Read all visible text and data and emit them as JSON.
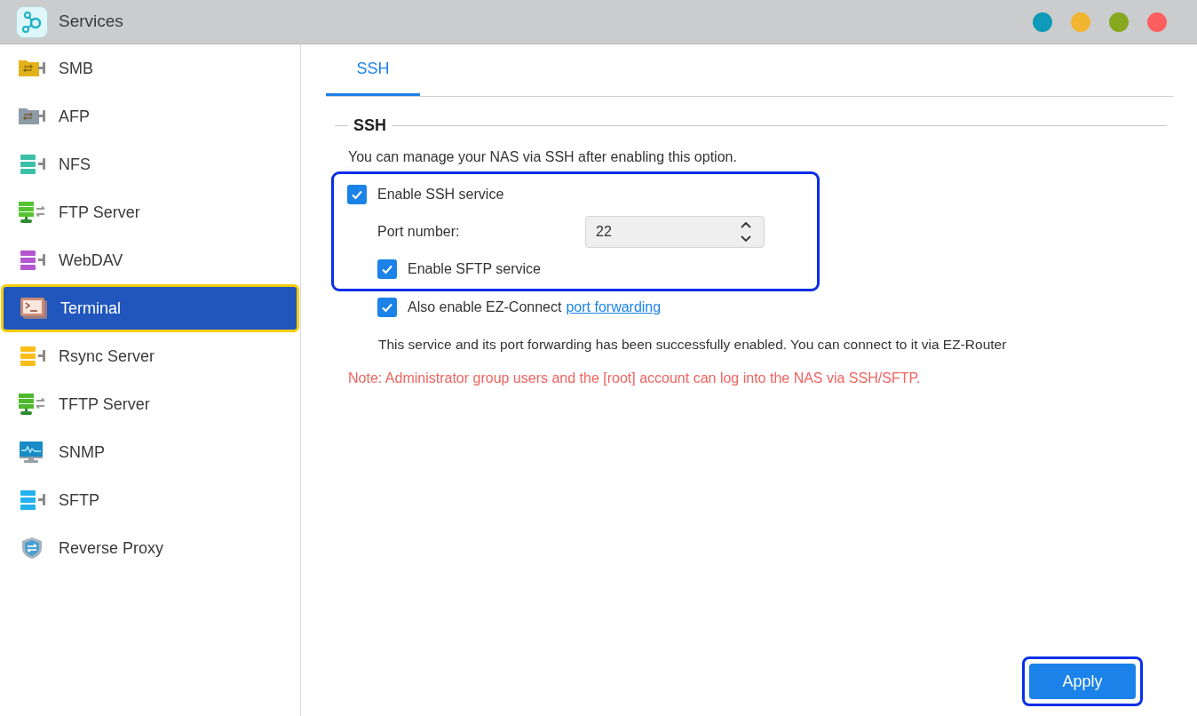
{
  "window": {
    "title": "Services",
    "controls": [
      {
        "color": "#0e9ab8"
      },
      {
        "color": "#f2b530"
      },
      {
        "color": "#86a81f"
      },
      {
        "color": "#fd5f5f"
      }
    ]
  },
  "sidebar": {
    "items": [
      {
        "label": "SMB",
        "selected": false,
        "kind": "folder",
        "color": "#e3b21a"
      },
      {
        "label": "AFP",
        "selected": false,
        "kind": "folder",
        "color": "#8d9ba6"
      },
      {
        "label": "NFS",
        "selected": false,
        "kind": "server",
        "color": "#3cbfa7"
      },
      {
        "label": "FTP Server",
        "selected": false,
        "kind": "network",
        "color": "#55c52f"
      },
      {
        "label": "WebDAV",
        "selected": false,
        "kind": "server",
        "color": "#b356cf"
      },
      {
        "label": "Terminal",
        "selected": true,
        "kind": "terminal",
        "color": "#c98a73"
      },
      {
        "label": "Rsync Server",
        "selected": false,
        "kind": "server",
        "color": "#fbbd18"
      },
      {
        "label": "TFTP Server",
        "selected": false,
        "kind": "network",
        "color": "#4cba2a"
      },
      {
        "label": "SNMP",
        "selected": false,
        "kind": "monitor",
        "color": "#1a8bc4"
      },
      {
        "label": "SFTP",
        "selected": false,
        "kind": "server",
        "color": "#23b1f0"
      },
      {
        "label": "Reverse Proxy",
        "selected": false,
        "kind": "shield",
        "color": "#4b9fd0"
      }
    ]
  },
  "tabs": [
    {
      "label": "SSH",
      "selected": true
    }
  ],
  "section": {
    "legend": "SSH",
    "description": "You can manage your NAS via SSH after enabling this option.",
    "options": [
      {
        "kind": "checkbox",
        "label": "Enable SSH service",
        "checked": true
      },
      {
        "kind": "number",
        "label": "Port number:",
        "value": "22"
      },
      {
        "kind": "checkbox",
        "label": "Enable SFTP service",
        "checked": true
      }
    ],
    "ez_connect": {
      "label": "Also enable EZ-Connect",
      "link": "port forwarding",
      "checked": true
    },
    "status": "This service and its port forwarding has been successfully enabled. You can connect to it via EZ-Router",
    "note": "Note: Administrator group users and the [root] account can log into the NAS via SSH/SFTP."
  },
  "apply": "Apply"
}
